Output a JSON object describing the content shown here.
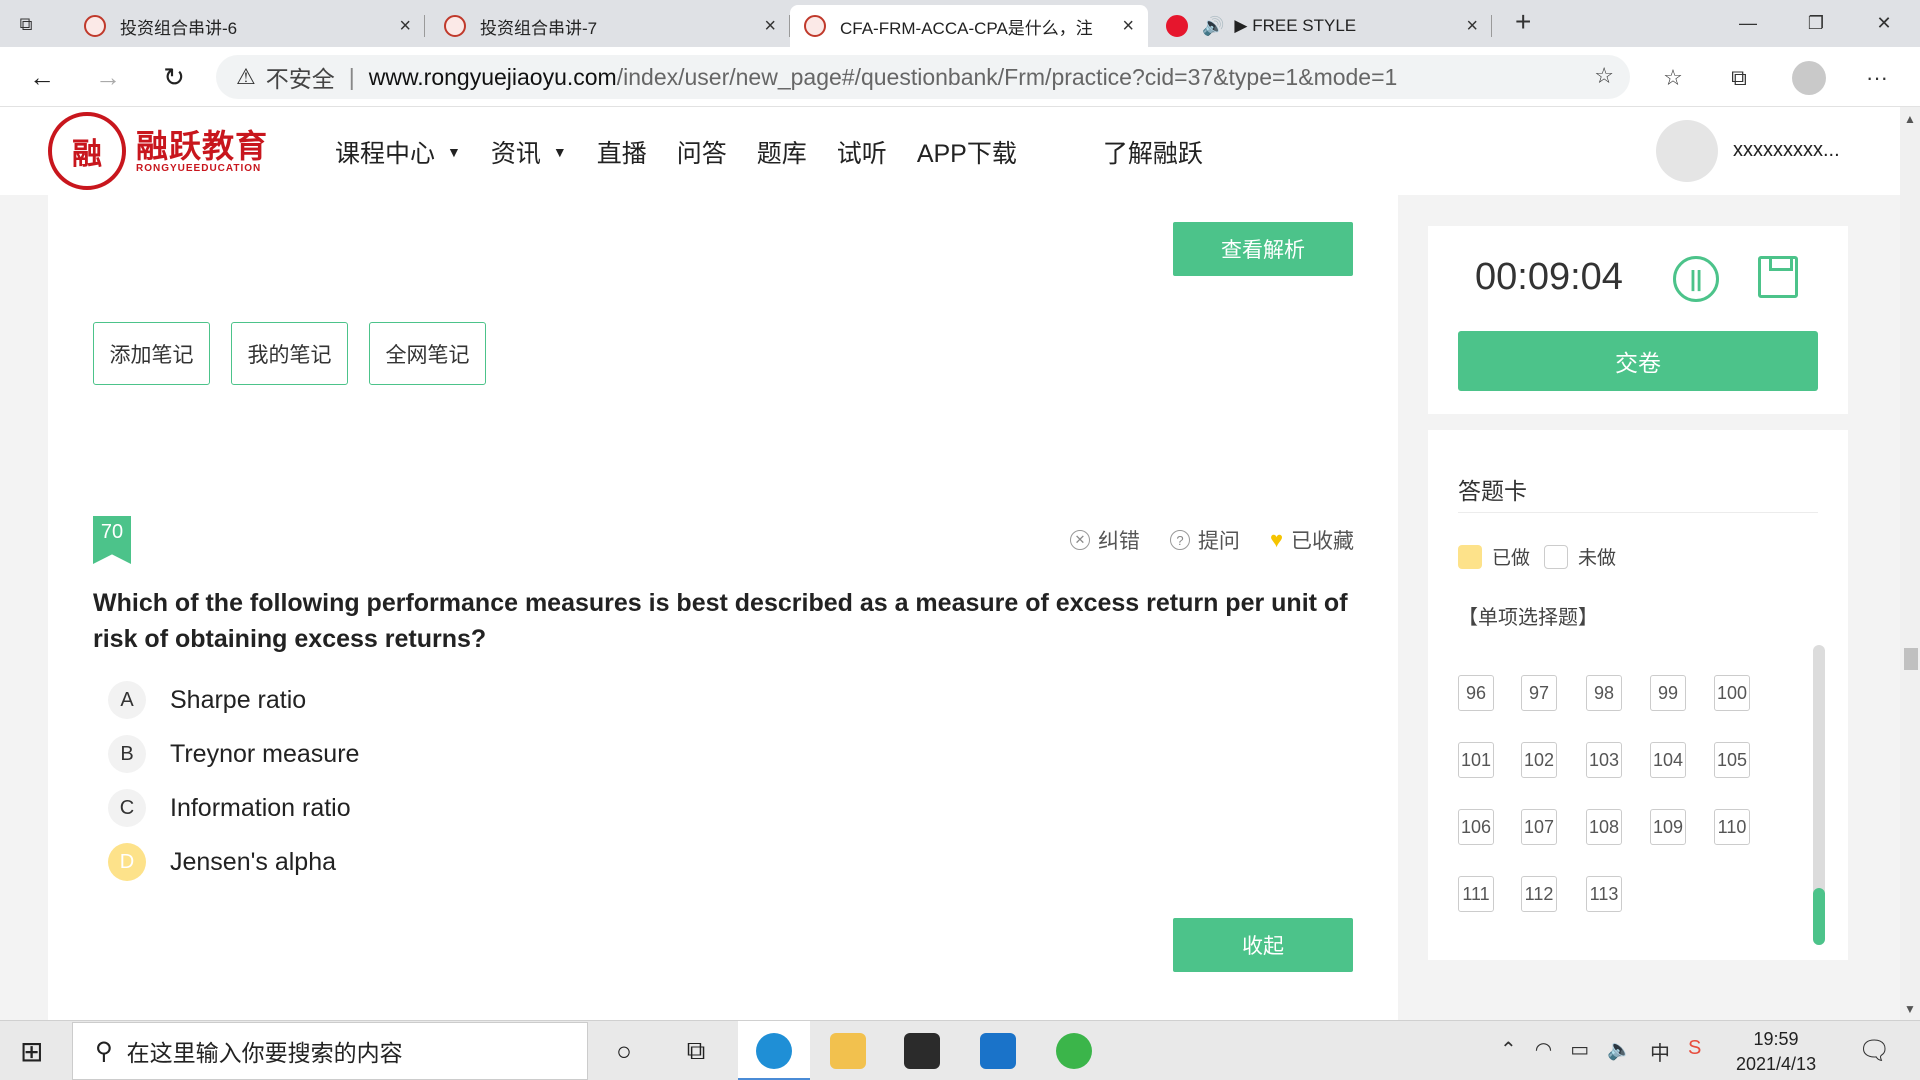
{
  "browser": {
    "tabs": [
      {
        "title": "投资组合串讲-6",
        "close": "×"
      },
      {
        "title": "投资组合串讲-7",
        "close": "×"
      },
      {
        "title": "CFA-FRM-ACCA-CPA是什么，注",
        "close": "×"
      },
      {
        "title": "▶ FREE STYLE",
        "close": "×"
      }
    ],
    "new_tab": "+",
    "window_controls": {
      "minimize": "—",
      "restore": "❐",
      "close": "✕"
    },
    "nav": {
      "back": "←",
      "forward": "→",
      "refresh": "↻"
    },
    "security_label": "不安全",
    "url_host": "www.rongyuejiaoyu.com",
    "url_path": "/index/user/new_page#/questionbank/Frm/practice?cid=37&type=1&mode=1",
    "more": "···"
  },
  "site": {
    "logo_seal": "融",
    "logo_cn": "融跃教育",
    "logo_en": "RONGYUEEDUCATION",
    "menu": [
      "课程中心",
      "资讯",
      "直播",
      "问答",
      "题库",
      "试听",
      "APP下载",
      "了解融跃"
    ],
    "user_name": "xxxxxxxxx..."
  },
  "main": {
    "view_analysis": "查看解析",
    "note_buttons": [
      "添加笔记",
      "我的笔记",
      "全网笔记"
    ],
    "question_number": "70",
    "actions": {
      "report": "纠错",
      "ask": "提问",
      "favorited": "已收藏"
    },
    "question": "Which of the following performance measures is best described as a measure of excess return per unit of risk of obtaining excess returns?",
    "options": [
      {
        "letter": "A",
        "text": "Sharpe ratio"
      },
      {
        "letter": "B",
        "text": "Treynor measure"
      },
      {
        "letter": "C",
        "text": "Information ratio"
      },
      {
        "letter": "D",
        "text": "Jensen's alpha"
      }
    ],
    "selected_option": "D",
    "collapse": "收起"
  },
  "timer": {
    "time": "00:09:04",
    "submit": "交卷"
  },
  "answer_card": {
    "title": "答题卡",
    "legend_done": "已做",
    "legend_undone": "未做",
    "section": "【单项选择题】",
    "numbers": [
      "96",
      "97",
      "98",
      "99",
      "100",
      "101",
      "102",
      "103",
      "104",
      "105",
      "106",
      "107",
      "108",
      "109",
      "110",
      "111",
      "112",
      "113"
    ]
  },
  "taskbar": {
    "search_placeholder": "在这里输入你要搜索的内容",
    "time": "19:59",
    "date": "2021/4/13",
    "ime": "中"
  },
  "colors": {
    "accent": "#4cc38a",
    "selected": "#fde28a",
    "brand": "#c8161d"
  }
}
